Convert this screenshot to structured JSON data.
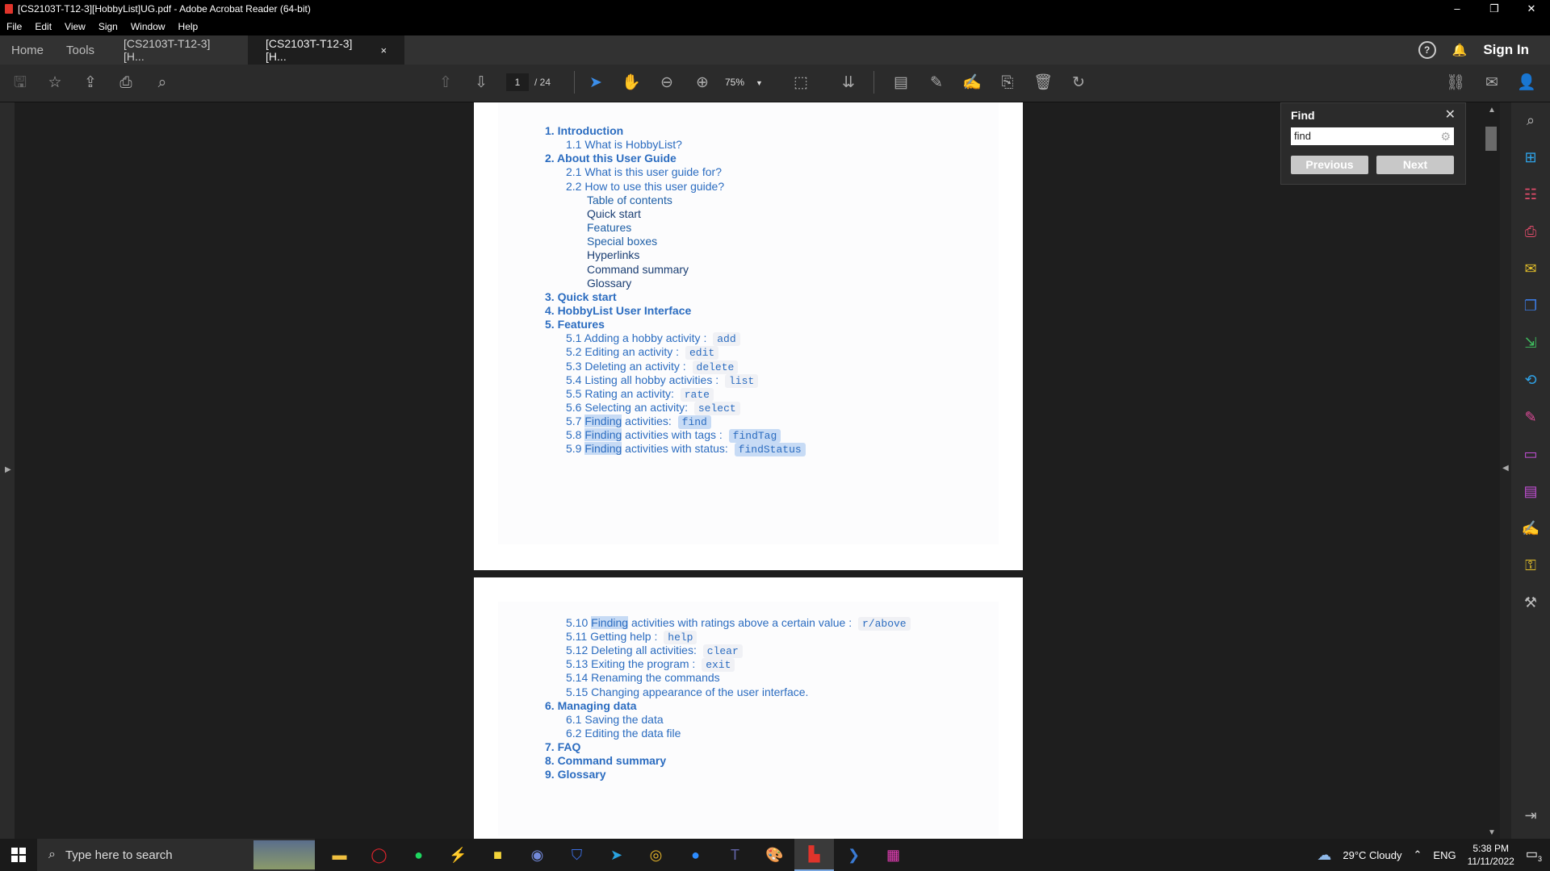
{
  "window": {
    "title": "[CS2103T-T12-3][HobbyList]UG.pdf - Adobe Acrobat Reader (64-bit)",
    "minimize": "–",
    "restore": "❐",
    "close": "✕"
  },
  "menu": [
    "File",
    "Edit",
    "View",
    "Sign",
    "Window",
    "Help"
  ],
  "tabs": {
    "home": "Home",
    "tools": "Tools",
    "doc1": "[CS2103T-T12-3][H...",
    "doc2": "[CS2103T-T12-3][H...",
    "close": "×",
    "help": "?",
    "bell": "🔔",
    "signin": "Sign In"
  },
  "toolbar": {
    "page_current": "1",
    "page_total": "/ 24",
    "zoom": "75%"
  },
  "find": {
    "title": "Find",
    "value": "find",
    "previous": "Previous",
    "next": "Next",
    "close": "✕"
  },
  "colorbar": [
    "#7fdbe6",
    "#86b3d9",
    "#f08f7f",
    "#e5567a"
  ],
  "toc_page1": [
    {
      "level": 1,
      "text": "1. Introduction"
    },
    {
      "level": 2,
      "text": "1.1 What is HobbyList?"
    },
    {
      "level": 1,
      "text": "2. About this User Guide"
    },
    {
      "level": 2,
      "text": "2.1 What is this user guide for?"
    },
    {
      "level": 2,
      "text": "2.2 How to use this user guide?"
    },
    {
      "level": 3,
      "text": "Table of contents"
    },
    {
      "level": 3,
      "text": "Quick start",
      "dark": true
    },
    {
      "level": 3,
      "text": "Features"
    },
    {
      "level": 3,
      "text": "Special boxes"
    },
    {
      "level": 3,
      "text": "Hyperlinks",
      "dark": true
    },
    {
      "level": 3,
      "text": "Command summary",
      "dark": true
    },
    {
      "level": 3,
      "text": "Glossary",
      "dark": true
    },
    {
      "level": 1,
      "text": "3. Quick start"
    },
    {
      "level": 1,
      "text": "4. HobbyList User Interface"
    },
    {
      "level": 1,
      "text": "5. Features"
    },
    {
      "level": 2,
      "pre": "5.1 Adding a hobby activity : ",
      "code": "add"
    },
    {
      "level": 2,
      "pre": "5.2 Editing an activity : ",
      "code": "edit"
    },
    {
      "level": 2,
      "pre": "5.3 Deleting an activity : ",
      "code": "delete"
    },
    {
      "level": 2,
      "pre": "5.4 Listing all hobby activities : ",
      "code": "list"
    },
    {
      "level": 2,
      "pre": "5.5 Rating an activity: ",
      "code": "rate"
    },
    {
      "level": 2,
      "pre": "5.6 Selecting an activity: ",
      "code": "select"
    },
    {
      "level": 2,
      "pre": "5.7 ",
      "hl": "Finding",
      "post": " activities: ",
      "code": "find",
      "codehl": true
    },
    {
      "level": 2,
      "pre": "5.8 ",
      "hl": "Finding",
      "post": " activities with tags : ",
      "code": "findTag",
      "codehl": true
    },
    {
      "level": 2,
      "pre": "5.9 ",
      "hl": "Finding",
      "post": " activities with status: ",
      "code": "findStatus",
      "codehl": true
    }
  ],
  "toc_page2": [
    {
      "level": 2,
      "pre": "5.10 ",
      "hl": "Finding",
      "post": " activities with ratings above a certain value : ",
      "code": "r/above"
    },
    {
      "level": 2,
      "pre": "5.11 Getting help : ",
      "code": "help"
    },
    {
      "level": 2,
      "pre": "5.12 Deleting all activities: ",
      "code": "clear"
    },
    {
      "level": 2,
      "pre": "5.13 Exiting the program : ",
      "code": "exit"
    },
    {
      "level": 2,
      "text": "5.14 Renaming the commands"
    },
    {
      "level": 2,
      "text": "5.15 Changing appearance of the user interface."
    },
    {
      "level": 1,
      "text": "6. Managing data"
    },
    {
      "level": 2,
      "text": "6.1 Saving the data"
    },
    {
      "level": 2,
      "text": "6.2 Editing the data file"
    },
    {
      "level": 1,
      "text": "7. FAQ"
    },
    {
      "level": 1,
      "text": "8. Command summary"
    },
    {
      "level": 1,
      "text": "9. Glossary"
    }
  ],
  "taskbar": {
    "search_placeholder": "Type here to search",
    "weather": "29°C  Cloudy",
    "lang": "ENG",
    "time": "5:38 PM",
    "date": "11/11/2022",
    "notif": "3"
  }
}
